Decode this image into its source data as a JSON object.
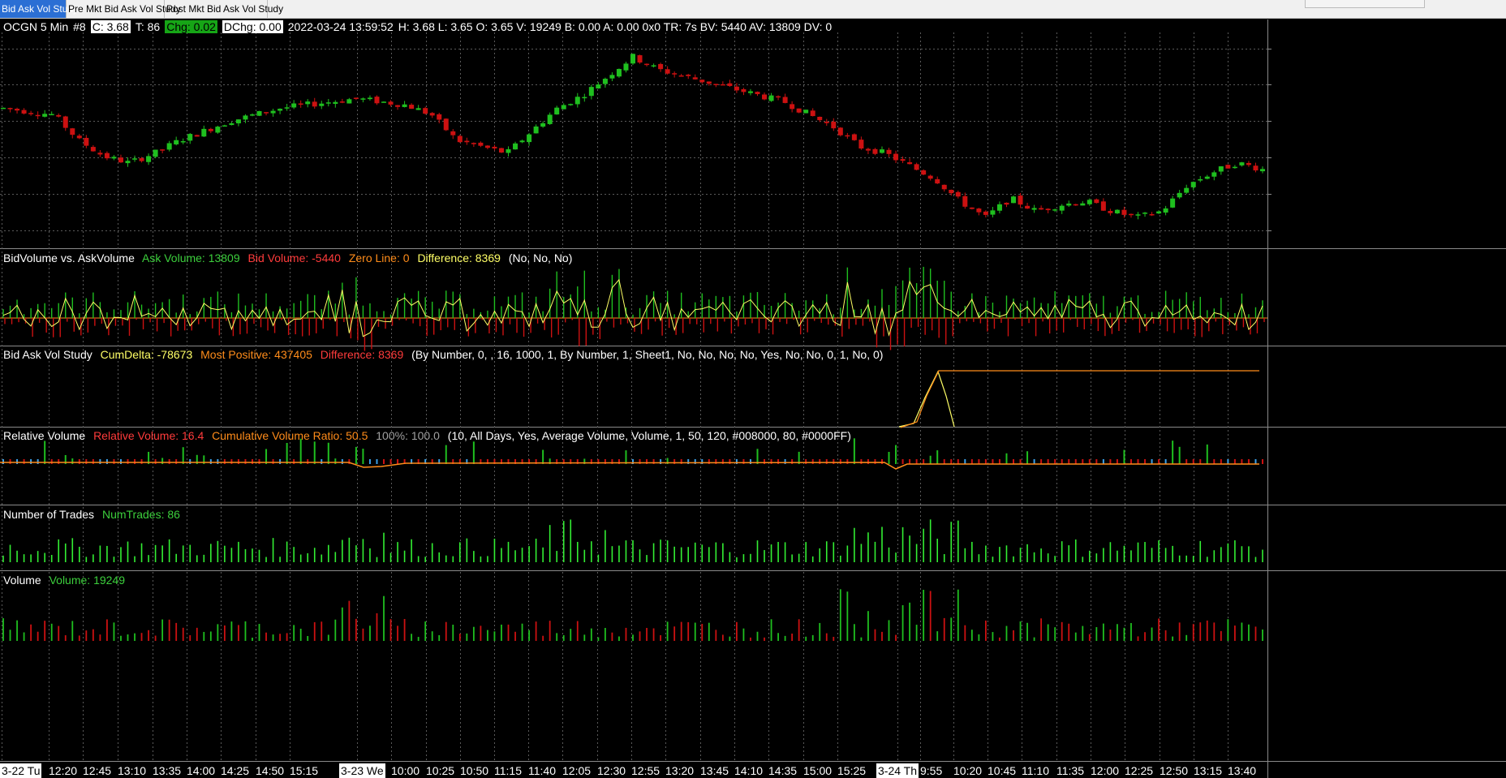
{
  "tabs": [
    {
      "label": "Bid Ask Vol Study",
      "active": true
    },
    {
      "label": "Pre Mkt Bid Ask Vol Study",
      "active": false
    },
    {
      "label": "Post Mkt Bid Ask Vol Study",
      "active": false
    }
  ],
  "header": {
    "symbol": "OCGN  5 Min",
    "index": "#8",
    "close": "C: 3.68",
    "ticks": "T: 86",
    "chg": "Chg: 0.02",
    "dchg": "DChg: 0.00",
    "datetime": "2022-03-24 13:59:52",
    "rest": "H: 3.68  L: 3.65  O: 3.65  V: 19249  B: 0.00  A: 0.00 0x0  TR: 7s  BV: 5440  AV: 13809  DV: 0"
  },
  "studies": {
    "bidask": {
      "name": "BidVolume vs. AskVolume",
      "ask": "Ask Volume: 13809",
      "bid": "Bid Volume: -5440",
      "zero": "Zero Line: 0",
      "diff": "Difference: 8369",
      "params": "(No, No, No)"
    },
    "bavs": {
      "name": "Bid Ask Vol Study",
      "cum": "CumDelta: -78673",
      "most": "Most Positive: 437405",
      "diff": "Difference: 8369",
      "params": "(By Number, 0, , 16, 1000, 1, By Number, 1, Sheet1, No, No, No, No, Yes, No, No, 0, 1, No, 0)"
    },
    "relvol": {
      "name": "Relative Volume",
      "rel": "Relative Volume: 16.4",
      "cum": "Cumulative Volume Ratio: 50.5",
      "pct": "100%: 100.0",
      "params": "(10, All Days, Yes, Average Volume, Volume, 1, 50, 120, #008000, 80, #0000FF)"
    },
    "trades": {
      "name": "Number of Trades",
      "val": "NumTrades: 86"
    },
    "volume": {
      "name": "Volume",
      "val": "Volume: 19249"
    }
  },
  "x_axis": [
    {
      "label": "3-22 Tu",
      "highlight": true
    },
    {
      "label": "12:20"
    },
    {
      "label": "12:45"
    },
    {
      "label": "13:10"
    },
    {
      "label": "13:35"
    },
    {
      "label": "14:00"
    },
    {
      "label": "14:25"
    },
    {
      "label": "14:50"
    },
    {
      "label": "15:15"
    },
    {
      "label": "3-23 We",
      "highlight": true
    },
    {
      "label": "10:00"
    },
    {
      "label": "10:25"
    },
    {
      "label": "10:50"
    },
    {
      "label": "11:15"
    },
    {
      "label": "11:40"
    },
    {
      "label": "12:05"
    },
    {
      "label": "12:30"
    },
    {
      "label": "12:55"
    },
    {
      "label": "13:20"
    },
    {
      "label": "13:45"
    },
    {
      "label": "14:10"
    },
    {
      "label": "14:35"
    },
    {
      "label": "15:00"
    },
    {
      "label": "15:25"
    },
    {
      "label": "3-24 Th",
      "highlight": true
    },
    {
      "label": "9:55"
    },
    {
      "label": "10:20"
    },
    {
      "label": "10:45"
    },
    {
      "label": "11:10"
    },
    {
      "label": "11:35"
    },
    {
      "label": "12:00"
    },
    {
      "label": "12:25"
    },
    {
      "label": "12:50"
    },
    {
      "label": "13:15"
    },
    {
      "label": "13:40"
    }
  ],
  "colors": {
    "up": "#1fbf1f",
    "down": "#cc1111",
    "grid": "#5a5a5a",
    "orange": "#ff8c1a",
    "yellow": "#ffff66",
    "trades": "#33ee33",
    "relvol_blue": "#3aa0e8"
  },
  "chart_data": {
    "type": "candlestick",
    "symbol": "OCGN",
    "interval": "5 Min",
    "close_path_pattern": [
      3.62,
      3.61,
      3.6,
      3.52,
      3.47,
      3.45,
      3.48,
      3.52,
      3.55,
      3.58,
      3.6,
      3.62,
      3.63,
      3.64,
      3.65,
      3.64,
      3.63,
      3.6,
      3.52,
      3.5,
      3.48,
      3.55,
      3.62,
      3.66,
      3.72,
      3.78,
      3.74,
      3.72,
      3.7,
      3.68,
      3.66,
      3.64,
      3.6,
      3.56,
      3.5,
      3.48,
      3.44,
      3.4,
      3.33,
      3.28,
      3.34,
      3.3,
      3.32,
      3.33,
      3.3,
      3.28,
      3.3,
      3.38,
      3.42,
      3.45,
      3.43
    ]
  }
}
